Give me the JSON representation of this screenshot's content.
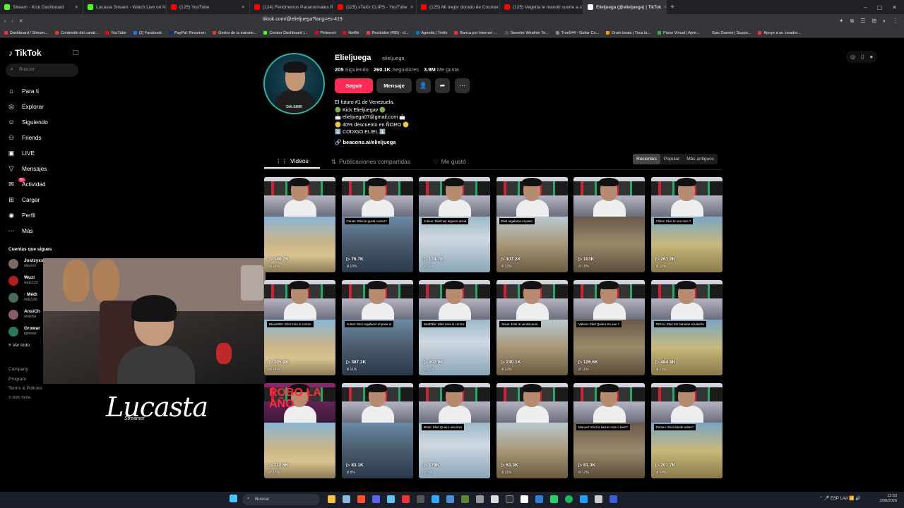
{
  "browser": {
    "tabs": [
      {
        "title": "Stream - Kick Dashboard",
        "color": "#53fc18"
      },
      {
        "title": "Lucasta Stream - Watch Live on Kick",
        "color": "#53fc18"
      },
      {
        "title": "(125) YouTube",
        "color": "#ff0000"
      },
      {
        "title": "(124) Fenómenos Paranormales Real",
        "color": "#ff0000"
      },
      {
        "title": "(125) sTaXx CLIPS - YouTube",
        "color": "#ff0000"
      },
      {
        "title": "(125) Mi mejor dorado de Counter St",
        "color": "#ff0000"
      },
      {
        "title": "(125) Vegetta le mandó suerte a sTa",
        "color": "#ff0000"
      },
      {
        "title": "Elieljuega (@elieljuega) | TikTok",
        "color": "#ffffff",
        "active": true
      }
    ],
    "new_tab": "+",
    "window_controls": [
      "–",
      "▢",
      "✕"
    ],
    "url": "tiktok.com/@elieljuega?lang=es-419",
    "bookmarks": [
      "Dashboard / Stream...",
      "Contenido del canal...",
      "YouTube",
      "(2) Facebook",
      "PayPal: Resumen",
      "Gestor de la transmi...",
      "Creator Dashboard |...",
      "Pinterest",
      "Netflix",
      "Recibidos (495) - cl...",
      "Agenda | Trello",
      "Banca por Internet -...",
      "Sweeter Weather Te...",
      "Tron544 - Guitar Co...",
      "Drum beats | Toca la...",
      "Piano Virtual | Apre...",
      "Epic Games | Suppo...",
      "Apoye a un creador..."
    ]
  },
  "sidebar": {
    "logo": "TikTok",
    "search_placeholder": "Buscar",
    "nav": [
      {
        "label": "Para ti",
        "icon": "home-icon"
      },
      {
        "label": "Explorar",
        "icon": "compass-icon"
      },
      {
        "label": "Siguiendo",
        "icon": "following-icon"
      },
      {
        "label": "Friends",
        "icon": "friends-icon"
      },
      {
        "label": "LIVE",
        "icon": "live-icon"
      },
      {
        "label": "Mensajes",
        "icon": "messages-icon"
      },
      {
        "label": "Actividad",
        "icon": "activity-icon",
        "badge": "52"
      },
      {
        "label": "Cargar",
        "icon": "upload-icon"
      },
      {
        "label": "Perfil",
        "icon": "profile-icon"
      },
      {
        "label": "Más",
        "icon": "more-icon"
      }
    ],
    "following_header": "Cuentas que sigues",
    "following": [
      {
        "name": "Jostzyxs",
        "handle": "stevznx"
      },
      {
        "name": "Wuzi",
        "handle": "wuzi.123"
      },
      {
        "name": "· Médi",
        "handle": "mds12l6"
      },
      {
        "name": "AnsiCh",
        "handle": "ansiche"
      },
      {
        "name": "Growar",
        "handle": "igrowan"
      }
    ],
    "see_all": "Ver todo",
    "footer": [
      "Company",
      "Program",
      "Terms & Policies"
    ],
    "copyright": "© 2026 TikTok"
  },
  "overlay": {
    "signature": "Lucasta",
    "signature_sub": "Streamer"
  },
  "profile": {
    "username": "Elieljuega",
    "handle": "elieljuega",
    "pfp_label": "DIA.SMIR",
    "following_count": "205",
    "following_label": "Siguiendo",
    "followers_count": "260.1K",
    "followers_label": "Seguidores",
    "likes_count": "3.9M",
    "likes_label": "Me gusta",
    "follow_btn": "Seguir",
    "message_btn": "Mensaje",
    "bio": [
      "El futuro #1 de Venezuela.",
      "🟢 Kick Elieljuegav 🟢",
      "📩 elieljuega07@gmail.com 📩",
      "🪙 40% descuento en ÑORO 🪙",
      "⬇️ CODIGO ELIEL ⬇️"
    ],
    "link": "beacons.ai/elieljuega"
  },
  "tabs": {
    "videos": "Videos",
    "reposts": "Publicaciones compartidas",
    "liked": "Me gustó"
  },
  "sort": {
    "recent": "Recientes",
    "popular": "Popular",
    "oldest": "Más antiguos"
  },
  "videos": [
    {
      "views": "146.7K",
      "pct": "14%",
      "caption": ""
    },
    {
      "views": "76.7K",
      "pct": "10%",
      "caption": "Carias: Eliel le gusta comer?"
    },
    {
      "views": "174.7K",
      "pct": "10%",
      "caption": "Joelos: Eliel hay alguien ansia"
    },
    {
      "views": "107.2K",
      "pct": "12%",
      "caption": "Eliel regalame el pase"
    },
    {
      "views": "103K",
      "pct": "10%",
      "caption": ""
    },
    {
      "views": "261.2K",
      "pct": "10%",
      "caption": "Chikis: Eliel te veo raro ?"
    },
    {
      "views": "305.9K",
      "pct": "14%",
      "caption": "Blood3tile: Eliel mira lo correo"
    },
    {
      "views": "387.3K",
      "pct": "11%",
      "caption": "Yulest: Eliel regalame el pase el"
    },
    {
      "views": "302.9K",
      "pct": "13%",
      "caption": "Beat3tile: Eliel mira lo correo"
    },
    {
      "views": "230.1K",
      "pct": "12%",
      "caption": "Jesus: Eliel te ventiscaron."
    },
    {
      "views": "126.6K",
      "pct": "11%",
      "caption": "Valeria: Eliel Quiero en ese ?"
    },
    {
      "views": "484.8K",
      "pct": "13%",
      "caption": "ROHA: Eliel me banaste el tokeña"
    },
    {
      "views": "112.6K",
      "pct": "12%",
      "caption": "ROBO LA AÑO"
    },
    {
      "views": "83.1K",
      "pct": "8%",
      "caption": ""
    },
    {
      "views": "179K",
      "pct": "9%",
      "caption": "Brian: Eliel Quiero una Evo"
    },
    {
      "views": "63.3K",
      "pct": "11%",
      "caption": ""
    },
    {
      "views": "81.3K",
      "pct": "12%",
      "caption": "Manuel: Eliel la tiarras más o bien?"
    },
    {
      "views": "201.7K",
      "pct": "14%",
      "caption": "Perseo: Eliel dónde estas?"
    }
  ],
  "taskbar": {
    "search": "Buscar",
    "lang": "ESP\nLAA",
    "time": "12:53",
    "date": "2/08/2026"
  }
}
